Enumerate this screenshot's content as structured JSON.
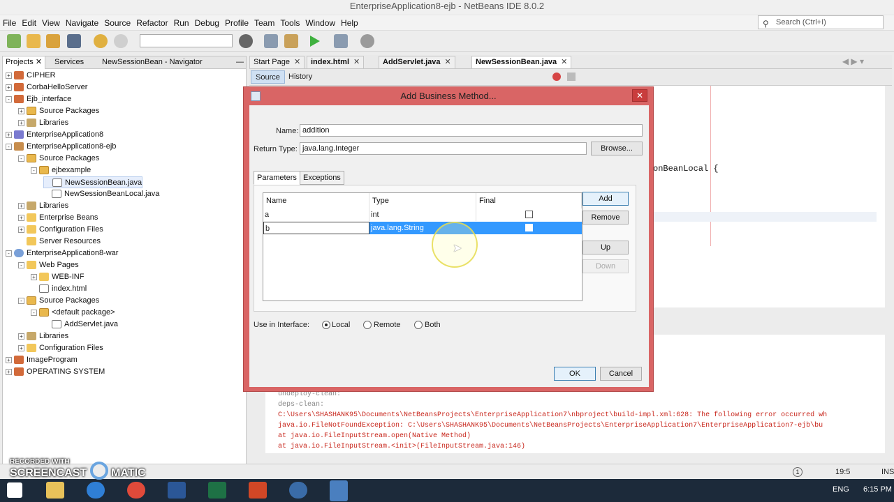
{
  "window": {
    "title": "EnterpriseApplication8-ejb - NetBeans IDE 8.0.2"
  },
  "menu": [
    "File",
    "Edit",
    "View",
    "Navigate",
    "Source",
    "Refactor",
    "Run",
    "Debug",
    "Profile",
    "Team",
    "Tools",
    "Window",
    "Help"
  ],
  "search": {
    "placeholder": "Search (Ctrl+I)"
  },
  "left_panel": {
    "tabs": [
      "Projects",
      "Services",
      "NewSessionBean - Navigator"
    ],
    "tree": [
      {
        "label": "CIPHER",
        "icon": "project-icon",
        "toggle": "+"
      },
      {
        "label": "CorbaHelloServer",
        "icon": "project-icon",
        "toggle": "+"
      },
      {
        "label": "Ejb_interface",
        "icon": "project-icon",
        "toggle": "-"
      },
      {
        "label": "Source Packages",
        "icon": "package-icon",
        "toggle": "+"
      },
      {
        "label": "Libraries",
        "icon": "library-icon",
        "toggle": "+"
      },
      {
        "label": "EnterpriseApplication8",
        "icon": "ear-icon",
        "toggle": "+"
      },
      {
        "label": "EnterpriseApplication8-ejb",
        "icon": "ejb-icon",
        "toggle": "-"
      },
      {
        "label": "Source Packages",
        "icon": "package-icon",
        "toggle": "-"
      },
      {
        "label": "ejbexample",
        "icon": "package-icon",
        "toggle": "-"
      },
      {
        "label": "NewSessionBean.java",
        "icon": "java-file-icon",
        "toggle": ""
      },
      {
        "label": "NewSessionBeanLocal.java",
        "icon": "java-file-icon",
        "toggle": ""
      },
      {
        "label": "Libraries",
        "icon": "library-icon",
        "toggle": "+"
      },
      {
        "label": "Enterprise Beans",
        "icon": "folder-icon",
        "toggle": "+"
      },
      {
        "label": "Configuration Files",
        "icon": "folder-icon",
        "toggle": "+"
      },
      {
        "label": "Server Resources",
        "icon": "folder-icon",
        "toggle": ""
      },
      {
        "label": "EnterpriseApplication8-war",
        "icon": "web-project-icon",
        "toggle": "-"
      },
      {
        "label": "Web Pages",
        "icon": "folder-icon",
        "toggle": "-"
      },
      {
        "label": "WEB-INF",
        "icon": "folder-icon",
        "toggle": "+"
      },
      {
        "label": "index.html",
        "icon": "html-file-icon",
        "toggle": ""
      },
      {
        "label": "Source Packages",
        "icon": "package-icon",
        "toggle": "-"
      },
      {
        "label": "<default package>",
        "icon": "package-icon",
        "toggle": "-"
      },
      {
        "label": "AddServlet.java",
        "icon": "java-file-icon",
        "toggle": ""
      },
      {
        "label": "Libraries",
        "icon": "library-icon",
        "toggle": "+"
      },
      {
        "label": "Configuration Files",
        "icon": "folder-icon",
        "toggle": "+"
      },
      {
        "label": "ImageProgram",
        "icon": "project-icon",
        "toggle": "+"
      },
      {
        "label": "OPERATING SYSTEM",
        "icon": "project-icon",
        "toggle": "+"
      }
    ]
  },
  "editor": {
    "tabs": [
      "Start Page",
      "index.html",
      "AddServlet.java",
      "NewSessionBean.java"
    ],
    "active_tab": "NewSessionBean.java",
    "subtabs": [
      "Source",
      "History"
    ],
    "visible_code": "onBeanLocal {"
  },
  "output": {
    "lines": [
      "undeploy-clean:",
      "deps-clean:",
      "C:\\Users\\SHASHANK95\\Documents\\NetBeansProjects\\EnterpriseApplication7\\nbproject\\build-impl.xml:628: The following error occurred wh",
      "java.io.FileNotFoundException: C:\\Users\\SHASHANK95\\Documents\\NetBeansProjects\\EnterpriseApplication7\\EnterpriseApplication7-ejb\\bu",
      "        at java.io.FileInputStream.open(Native Method)",
      "        at java.io.FileInputStream.<init>(FileInputStream.java:146)"
    ]
  },
  "dialog": {
    "title": "Add Business Method...",
    "name_label": "Name:",
    "name_value": "addition",
    "return_label": "Return Type:",
    "return_value": "java.lang.Integer",
    "browse_label": "Browse...",
    "tabs": [
      "Parameters",
      "Exceptions"
    ],
    "columns": [
      "Name",
      "Type",
      "Final"
    ],
    "rows": [
      {
        "name": "a",
        "type": "int",
        "final": false
      },
      {
        "name": "b",
        "type": "java.lang.String",
        "final": false
      }
    ],
    "buttons": {
      "add": "Add",
      "remove": "Remove",
      "up": "Up",
      "down": "Down",
      "ok": "OK",
      "cancel": "Cancel"
    },
    "interface_label": "Use in Interface:",
    "interface_options": [
      "Local",
      "Remote",
      "Both"
    ],
    "interface_selected": "Local"
  },
  "status": {
    "position": "19:5",
    "mode": "INS"
  },
  "taskbar": {
    "lang": "ENG",
    "time": "6:15 PM"
  },
  "watermark": {
    "line1": "RECORDED WITH",
    "line2": "SCREENCAST",
    "line3": "MATIC"
  }
}
